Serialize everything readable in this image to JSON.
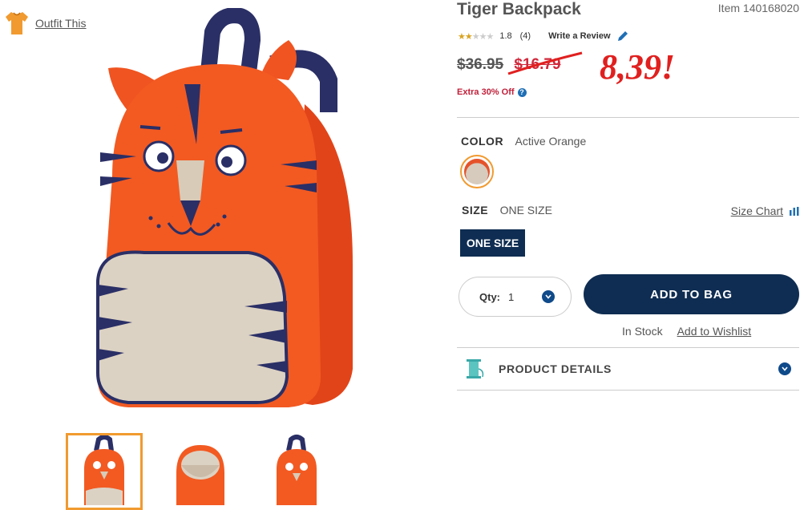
{
  "outfit": {
    "label": "Outfit This",
    "icon": "tshirt-icon"
  },
  "product": {
    "title": "Tiger Backpack",
    "item": "Item 140168020",
    "rating": {
      "value": "1.8",
      "count": "(4)",
      "stars_filled": 2,
      "stars_total": 5,
      "write_review": "Write a Review"
    },
    "price": {
      "original": "$36.95",
      "sale": "$16.79",
      "annotation": "8,39!"
    },
    "promo": "Extra 30% Off",
    "color": {
      "label": "COLOR",
      "value": "Active Orange"
    },
    "size": {
      "label": "SIZE",
      "value": "ONE SIZE",
      "option": "ONE SIZE",
      "size_chart": "Size Chart"
    },
    "qty": {
      "label": "Qty:",
      "value": "1"
    },
    "add_to_bag": "ADD TO BAG",
    "stock": "In Stock",
    "wishlist": "Add to Wishlist",
    "details_label": "PRODUCT DETAILS"
  },
  "colors": {
    "navy": "#0f2d52",
    "accent_orange": "#f19a2f",
    "sale_red": "#d0283b",
    "annotation_red": "#e0201f"
  }
}
